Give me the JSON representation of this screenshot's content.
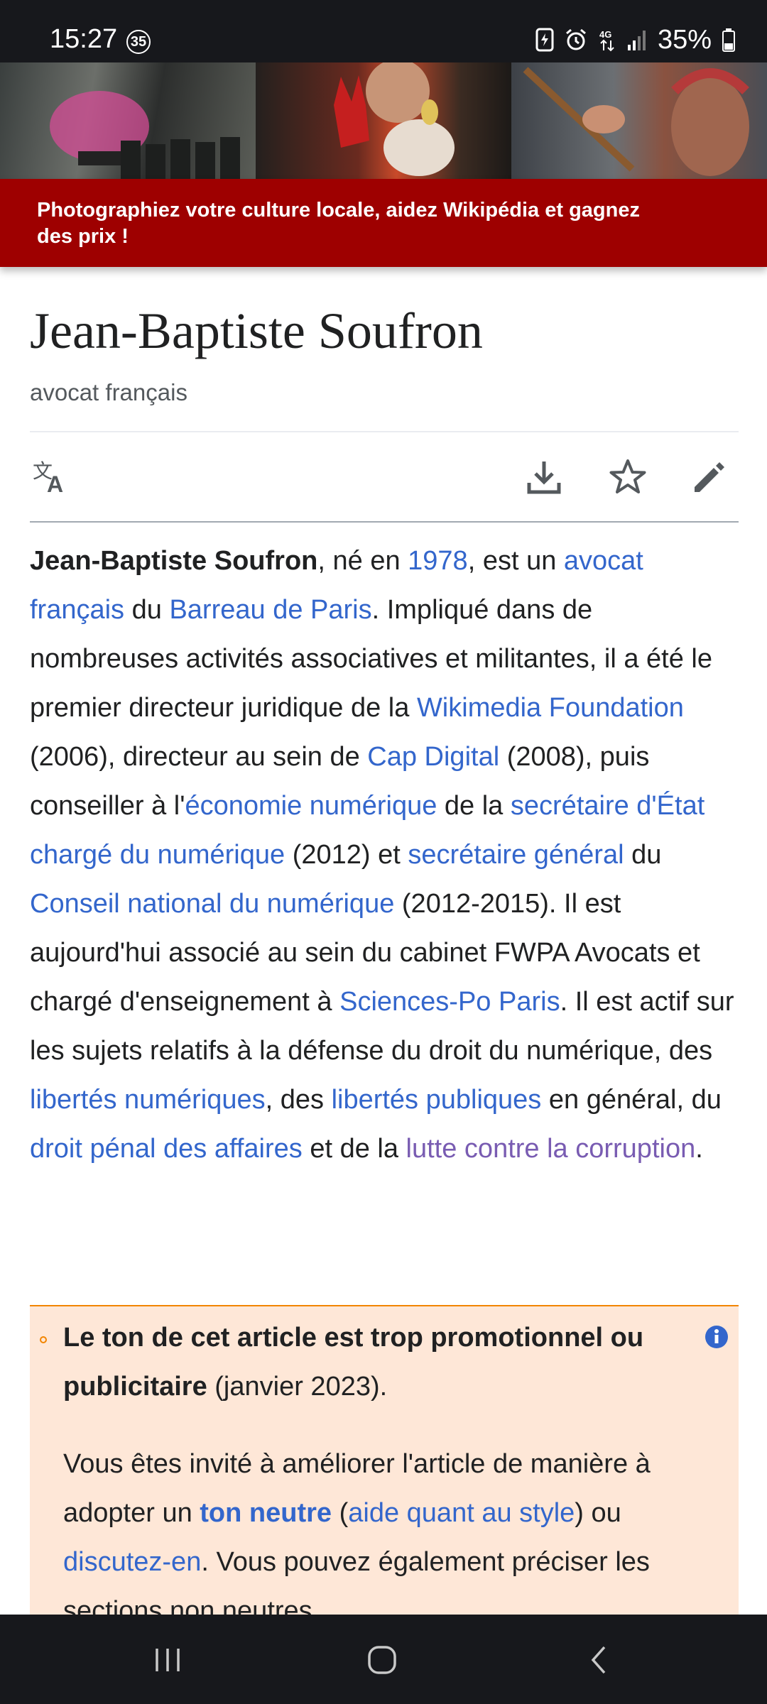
{
  "status_bar": {
    "time": "15:27",
    "notification_count": "35",
    "network": "4G",
    "battery": "35%"
  },
  "banner": {
    "text": "Photographiez votre culture locale, aidez Wikipédia et gagnez des prix !"
  },
  "page": {
    "title": "Jean-Baptiste Soufron",
    "description": "avocat français"
  },
  "toolbar": {
    "icons": [
      "translate-icon",
      "download-icon",
      "star-icon",
      "edit-icon"
    ]
  },
  "article": {
    "bold_name": "Jean-Baptiste Soufron",
    "t1": ", né en ",
    "l_1978": "1978",
    "t2": ", est un ",
    "l_avocat": "avocat français",
    "t3": " du ",
    "l_barreau": "Barreau de Paris",
    "t4": ". Impliqué dans de nombreuses activités associatives et militantes, il a été le premier directeur juridique de la ",
    "l_wmf": "Wikimedia Foundation",
    "t5": " (2006), directeur au sein de ",
    "l_cap": "Cap Digital",
    "t6": " (2008), puis conseiller à l'",
    "l_eco": "économie numérique",
    "t7": " de la ",
    "l_secetat": "secrétaire d'État chargé du numérique",
    "t8": " (2012) et ",
    "l_secgen": "secrétaire général",
    "t9": " du ",
    "l_cnn": "Conseil national du numérique",
    "t10": " (2012-2015). Il est aujourd'hui associé au sein du cabinet FWPA Avocats et chargé d'enseignement à ",
    "l_scpo": "Sciences-Po Paris",
    "t11": ". Il est actif sur les sujets relatifs à la défense du droit du numérique, des ",
    "l_libnum": "libertés numériques",
    "t12": ", des ",
    "l_libpub": "libertés publiques",
    "t13": " en général, du ",
    "l_penal": "droit pénal des affaires",
    "t14": " et de la ",
    "l_lutte": "lutte contre la corruption",
    "t15": "."
  },
  "notice": {
    "heading": "Le ton de cet article est trop promotionnel ou publicitaire",
    "date": " (janvier 2023).",
    "p1": "Vous êtes invité à améliorer l'article de manière à adopter un ",
    "l_ton": "ton neutre",
    "p2": " (",
    "l_aide": "aide quant au style",
    "p3": ") ou ",
    "l_disc": "discutez-en",
    "p4": ". Vous pouvez également préciser les sections non neutres"
  },
  "colors": {
    "link": "#3366cc",
    "visited_link": "#795cb2",
    "banner_red": "#9e0000",
    "notice_bg": "#fee7d7",
    "notice_border": "#f28500"
  }
}
